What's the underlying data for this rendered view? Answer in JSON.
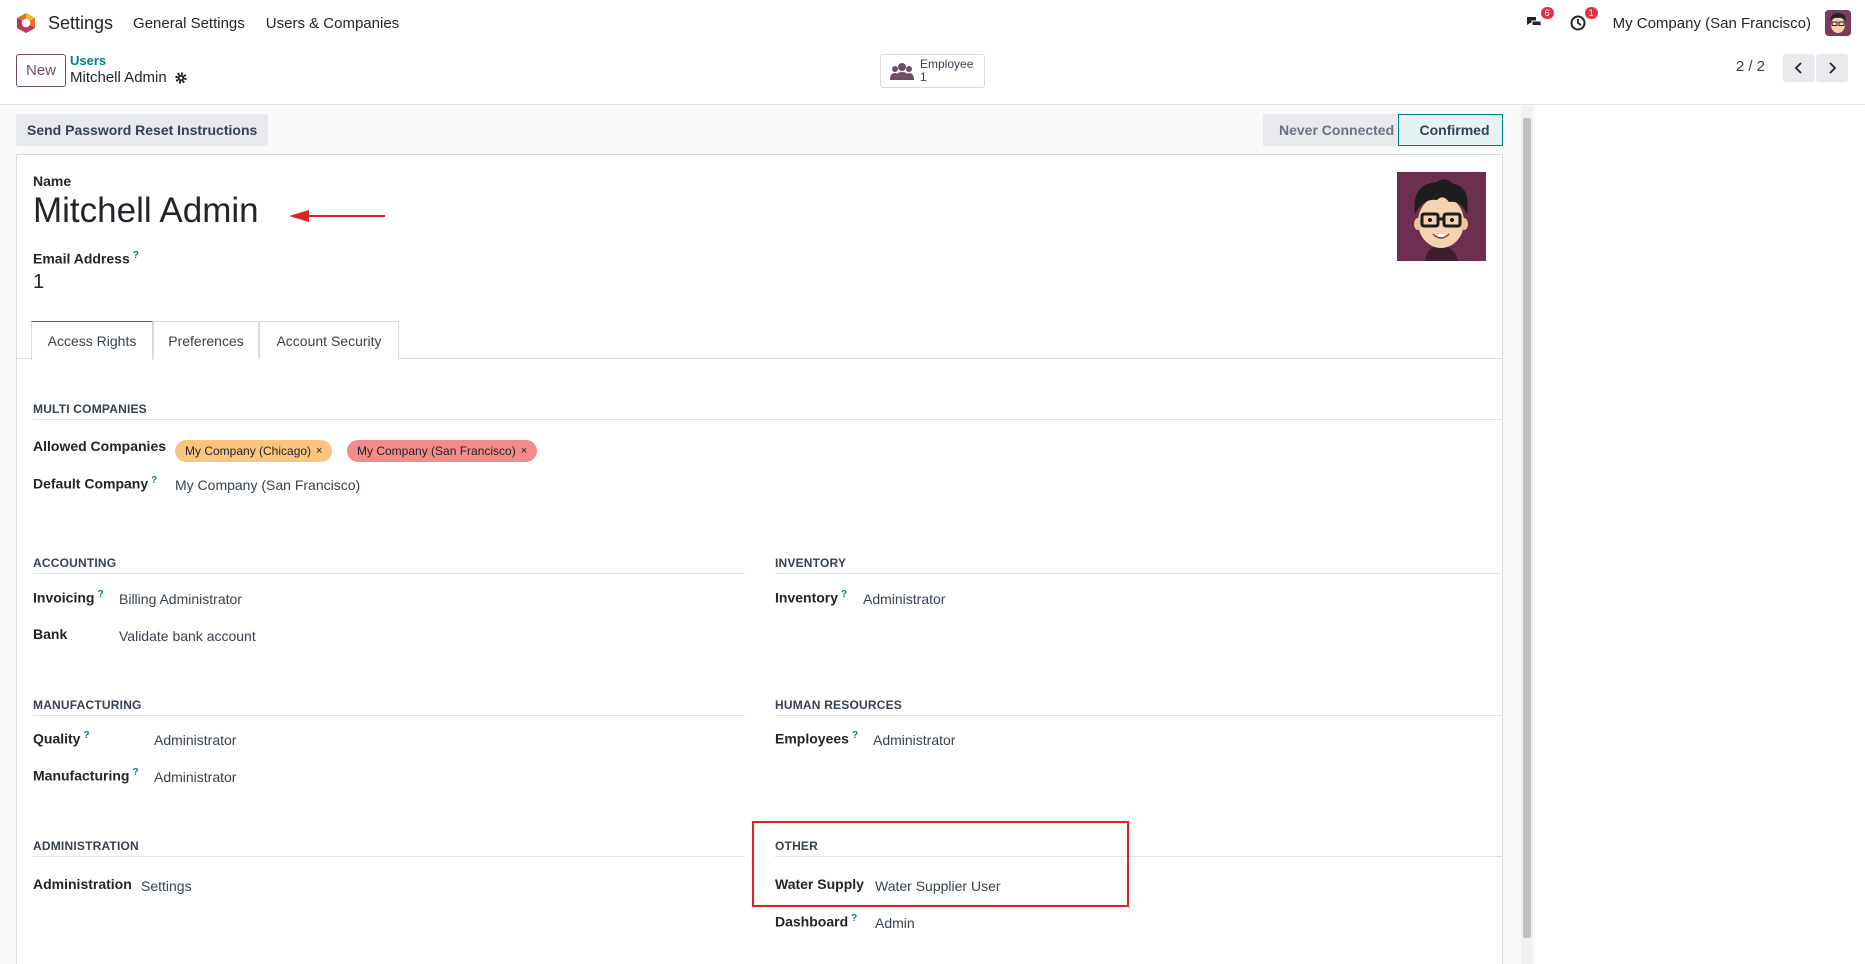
{
  "navbar": {
    "app_name": "Settings",
    "menu": [
      "General Settings",
      "Users & Companies"
    ],
    "messages_count": "6",
    "activities_count": "1",
    "company": "My Company (San Francisco)"
  },
  "control": {
    "new_label": "New",
    "breadcrumb_parent": "Users",
    "breadcrumb_current": "Mitchell Admin",
    "employee_label": "Employee",
    "employee_count": "1",
    "pager": "2 / 2"
  },
  "status": {
    "reset_button": "Send Password Reset Instructions",
    "stage_never": "Never Connected",
    "stage_confirmed": "Confirmed"
  },
  "form": {
    "name_label": "Name",
    "name_value": "Mitchell Admin",
    "email_label": "Email Address",
    "help_mark": "?",
    "email_value": "1"
  },
  "tabs": [
    "Access Rights",
    "Preferences",
    "Account Security"
  ],
  "multi_companies": {
    "title": "MULTI COMPANIES",
    "allowed_label": "Allowed Companies",
    "allowed_tags": [
      "My Company (Chicago)",
      "My Company (San Francisco)"
    ],
    "tag_remove": "×",
    "default_label": "Default Company",
    "default_value": "My Company (San Francisco)"
  },
  "accounting": {
    "title": "ACCOUNTING",
    "invoicing_label": "Invoicing",
    "invoicing_value": "Billing Administrator",
    "bank_label": "Bank",
    "bank_value": "Validate bank account"
  },
  "inventory": {
    "title": "INVENTORY",
    "inventory_label": "Inventory",
    "inventory_value": "Administrator"
  },
  "manufacturing": {
    "title": "MANUFACTURING",
    "quality_label": "Quality",
    "quality_value": "Administrator",
    "manufacturing_label": "Manufacturing",
    "manufacturing_value": "Administrator"
  },
  "human_resources": {
    "title": "HUMAN RESOURCES",
    "employees_label": "Employees",
    "employees_value": "Administrator"
  },
  "administration": {
    "title": "ADMINISTRATION",
    "administration_label": "Administration",
    "administration_value": "Settings"
  },
  "other": {
    "title": "OTHER",
    "water_label": "Water Supply",
    "water_value": "Water Supplier User",
    "dashboard_label": "Dashboard",
    "dashboard_value": "Admin"
  },
  "colors": {
    "brand": "#714b67",
    "teal": "#017e84",
    "tag_chicago": "#f9c57f",
    "tag_sf": "#f38b8b",
    "annotation": "#e02424"
  }
}
